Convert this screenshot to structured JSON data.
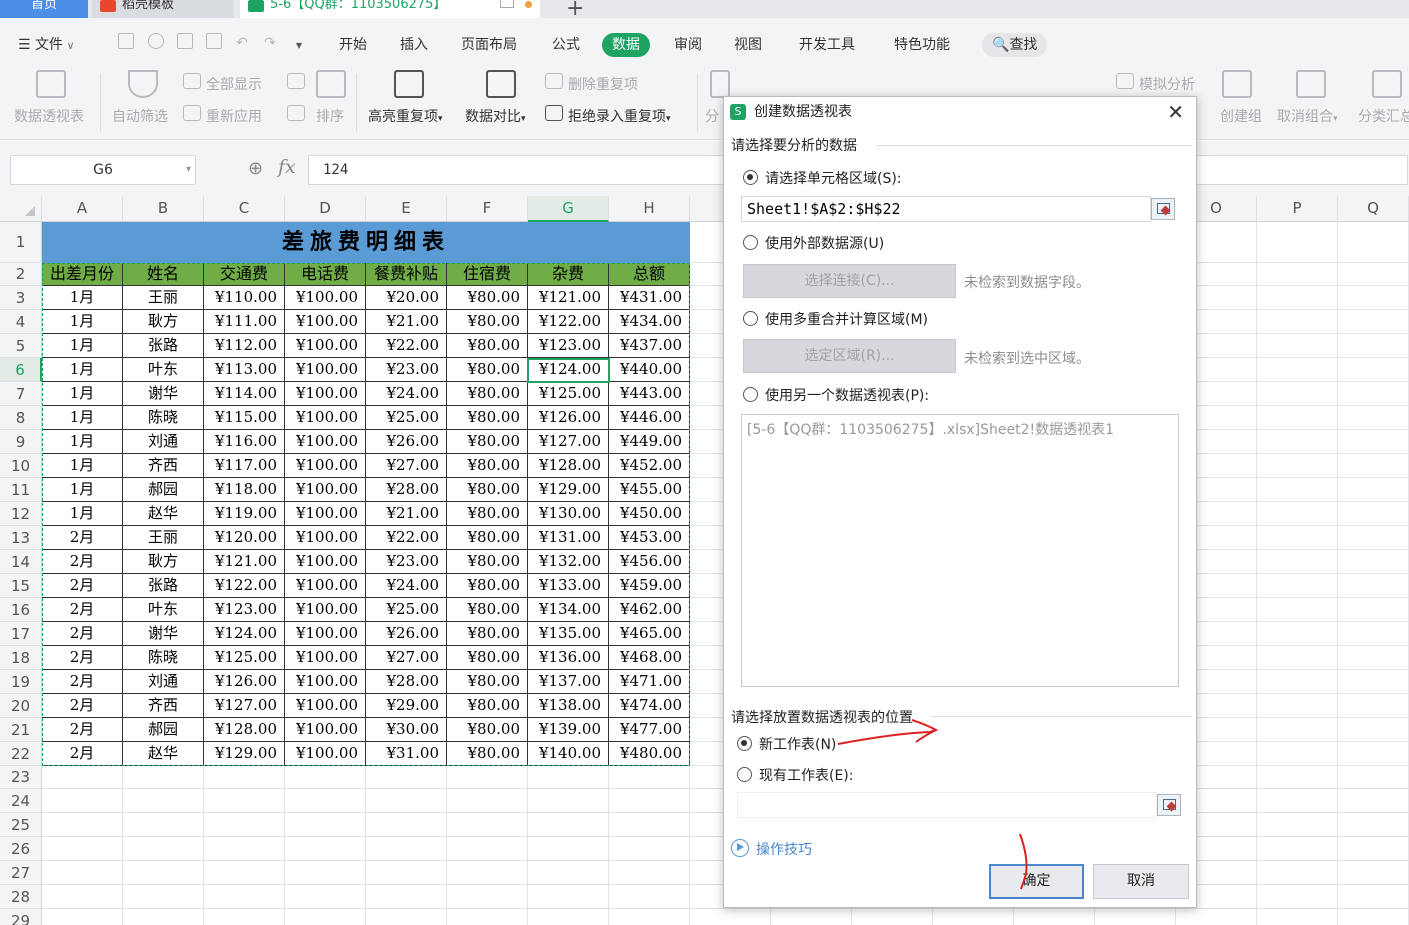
{
  "tabs": {
    "home": "首页",
    "daoke": "稻壳模板",
    "file": "5-6【QQ群：1103506275】"
  },
  "menu": {
    "file": "文件",
    "items": [
      "开始",
      "插入",
      "页面布局",
      "公式",
      "数据",
      "审阅",
      "视图",
      "开发工具",
      "特色功能"
    ],
    "search": "查找"
  },
  "ribbon": {
    "pivot": "数据透视表",
    "autofilter": "自动筛选",
    "show_all": "全部显示",
    "reapply": "重新应用",
    "sort": "排序",
    "highlight_dup": "高亮重复项",
    "compare": "数据对比",
    "remove_dup": "删除重复项",
    "reject_dup": "拒绝录入重复项",
    "split_partial": "分",
    "simulate": "模拟分析",
    "group": "创建组",
    "ungroup": "取消组合",
    "subtotal": "分类汇总"
  },
  "formula": {
    "cell_ref": "G6",
    "fx": "fx",
    "value": "124"
  },
  "columns": [
    "A",
    "B",
    "C",
    "D",
    "E",
    "F",
    "G",
    "H",
    "",
    "",
    "",
    "",
    "",
    "",
    "O",
    "P",
    "Q"
  ],
  "rows": [
    "1",
    "2",
    "3",
    "4",
    "5",
    "6",
    "7",
    "8",
    "9",
    "10",
    "11",
    "12",
    "13",
    "14",
    "15",
    "16",
    "17",
    "18",
    "19",
    "20",
    "21",
    "22",
    "23",
    "24",
    "25",
    "26",
    "27",
    "28",
    "29"
  ],
  "sheet": {
    "title": "差旅费明细表",
    "headers": [
      "出差月份",
      "姓名",
      "交通费",
      "电话费",
      "餐费补贴",
      "住宿费",
      "杂费",
      "总额"
    ],
    "data": [
      [
        "1月",
        "王丽",
        "¥110.00",
        "¥100.00",
        "¥20.00",
        "¥80.00",
        "¥121.00",
        "¥431.00"
      ],
      [
        "1月",
        "耿方",
        "¥111.00",
        "¥100.00",
        "¥21.00",
        "¥80.00",
        "¥122.00",
        "¥434.00"
      ],
      [
        "1月",
        "张路",
        "¥112.00",
        "¥100.00",
        "¥22.00",
        "¥80.00",
        "¥123.00",
        "¥437.00"
      ],
      [
        "1月",
        "叶东",
        "¥113.00",
        "¥100.00",
        "¥23.00",
        "¥80.00",
        "¥124.00",
        "¥440.00"
      ],
      [
        "1月",
        "谢华",
        "¥114.00",
        "¥100.00",
        "¥24.00",
        "¥80.00",
        "¥125.00",
        "¥443.00"
      ],
      [
        "1月",
        "陈晓",
        "¥115.00",
        "¥100.00",
        "¥25.00",
        "¥80.00",
        "¥126.00",
        "¥446.00"
      ],
      [
        "1月",
        "刘通",
        "¥116.00",
        "¥100.00",
        "¥26.00",
        "¥80.00",
        "¥127.00",
        "¥449.00"
      ],
      [
        "1月",
        "齐西",
        "¥117.00",
        "¥100.00",
        "¥27.00",
        "¥80.00",
        "¥128.00",
        "¥452.00"
      ],
      [
        "1月",
        "郝园",
        "¥118.00",
        "¥100.00",
        "¥28.00",
        "¥80.00",
        "¥129.00",
        "¥455.00"
      ],
      [
        "1月",
        "赵华",
        "¥119.00",
        "¥100.00",
        "¥21.00",
        "¥80.00",
        "¥130.00",
        "¥450.00"
      ],
      [
        "2月",
        "王丽",
        "¥120.00",
        "¥100.00",
        "¥22.00",
        "¥80.00",
        "¥131.00",
        "¥453.00"
      ],
      [
        "2月",
        "耿方",
        "¥121.00",
        "¥100.00",
        "¥23.00",
        "¥80.00",
        "¥132.00",
        "¥456.00"
      ],
      [
        "2月",
        "张路",
        "¥122.00",
        "¥100.00",
        "¥24.00",
        "¥80.00",
        "¥133.00",
        "¥459.00"
      ],
      [
        "2月",
        "叶东",
        "¥123.00",
        "¥100.00",
        "¥25.00",
        "¥80.00",
        "¥134.00",
        "¥462.00"
      ],
      [
        "2月",
        "谢华",
        "¥124.00",
        "¥100.00",
        "¥26.00",
        "¥80.00",
        "¥135.00",
        "¥465.00"
      ],
      [
        "2月",
        "陈晓",
        "¥125.00",
        "¥100.00",
        "¥27.00",
        "¥80.00",
        "¥136.00",
        "¥468.00"
      ],
      [
        "2月",
        "刘通",
        "¥126.00",
        "¥100.00",
        "¥28.00",
        "¥80.00",
        "¥137.00",
        "¥471.00"
      ],
      [
        "2月",
        "齐西",
        "¥127.00",
        "¥100.00",
        "¥29.00",
        "¥80.00",
        "¥138.00",
        "¥474.00"
      ],
      [
        "2月",
        "郝园",
        "¥128.00",
        "¥100.00",
        "¥30.00",
        "¥80.00",
        "¥139.00",
        "¥477.00"
      ],
      [
        "2月",
        "赵华",
        "¥129.00",
        "¥100.00",
        "¥31.00",
        "¥80.00",
        "¥140.00",
        "¥480.00"
      ]
    ]
  },
  "dialog": {
    "title": "创建数据透视表",
    "section1": "请选择要分析的数据",
    "opt_range": "请选择单元格区域(S):",
    "range_value": "Sheet1!$A$2:$H$22",
    "opt_external": "使用外部数据源(U)",
    "btn_connect": "选择连接(C)...",
    "hint_connect": "未检索到数据字段。",
    "opt_multi": "使用多重合并计算区域(M)",
    "btn_select_range": "选定区域(R)...",
    "hint_range": "未检索到选中区域。",
    "opt_other_pivot": "使用另一个数据透视表(P):",
    "pivot_item": "[5-6【QQ群：1103506275】.xlsx]Sheet2!数据透视表1",
    "section2": "请选择放置数据透视表的位置",
    "opt_new_sheet": "新工作表(N)",
    "opt_existing_sheet": "现有工作表(E):",
    "existing_value": "",
    "tips": "操作技巧",
    "ok": "确定",
    "cancel": "取消"
  },
  "colors": {
    "accent": "#1ea362",
    "title_fill": "#5b9bd5",
    "header_fill": "#70ad47",
    "annotation": "#e02020"
  }
}
